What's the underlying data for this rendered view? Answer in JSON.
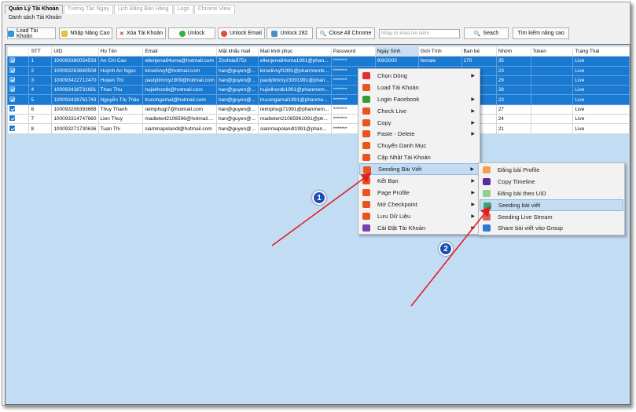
{
  "tabs": [
    "Quản Lý Tài Khoản",
    "Tương Tác Ngay",
    "Lịch Đăng Bán Hàng",
    "Logs",
    "Chrome View"
  ],
  "group_label": "Danh sách Tài Khoản",
  "toolbar": {
    "load": "Load Tài Khoản",
    "import": "Nhập Nâng Cao",
    "delete": "Xóa Tài Khoản",
    "unlock": "Unlock",
    "unlock_email": "Unlock Email",
    "unlock282": "Unlock 282",
    "close_chrome": "Close All Chrome",
    "search_placeholder": "Nhập từ khóa tìm kiếm",
    "search": "Seach",
    "advanced": "Tìm kiếm nâng cao"
  },
  "columns": [
    "",
    "STT",
    "UID",
    "Họ Tên",
    "Email",
    "Mật khẩu mail",
    "Mail khôi phục",
    "Password",
    "Ngày Sinh",
    "Giới Tính",
    "Bạn bè",
    "Nhóm",
    "Token",
    "Trạng Thái"
  ],
  "rows": [
    {
      "sel": true,
      "c": [
        "",
        "1",
        "100093380054533",
        "An Chi Cao",
        "ellenjena84oma@hotmail.com",
        "Zzohda975z",
        "ellenjena84oma1991@phan...",
        "*******",
        "9/8/2000",
        "female",
        "170",
        "35",
        "",
        "Live"
      ]
    },
    {
      "sel": true,
      "c": [
        "",
        "2",
        "100093263840508",
        "Huỳnh An Ngọc",
        "kirselivvyf@hotmail.com",
        "han@guyen@...",
        "kirselivvyf1991@phanmemb...",
        "*******",
        "10/14/1998",
        "female",
        "230",
        "23",
        "",
        "Live"
      ]
    },
    {
      "sel": true,
      "c": [
        "",
        "3",
        "100093422712470",
        "Huyen Thi",
        "paulytimmyz309@hotmail.com",
        "han@guyen@...",
        "paulytimmyz3091991@phan...",
        "*******",
        "",
        "",
        "",
        "29",
        "",
        "Live"
      ]
    },
    {
      "sel": true,
      "c": [
        "",
        "4",
        "100093438731691",
        "Thao Thu",
        "hujielhordb@hotmail.com",
        "han@guyen@...",
        "hujielhordb1991@phanmem...",
        "*******",
        "",
        "",
        "",
        "28",
        "",
        "Live"
      ]
    },
    {
      "sel": true,
      "c": [
        "",
        "5",
        "100093438761743",
        "Nguyễn Thị Thảo",
        "trucongamal@hotmail.com",
        "han@guyen@...",
        "trucongamal1991@phanme...",
        "*******",
        "",
        "",
        "",
        "23",
        "",
        "Live"
      ]
    },
    {
      "sel": false,
      "c": [
        "",
        "6",
        "100093206393668",
        "Thuy Thanh",
        "reimphugi7@hotmail.com",
        "han@guyen@...",
        "reimphugi71991@phanmem...",
        "*******",
        "",
        "",
        "",
        "27",
        "",
        "Live"
      ]
    },
    {
      "sel": false,
      "c": [
        "",
        "7",
        "100093314747660",
        "Lien Thuy",
        "madietert2106596@hotmail....",
        "han@guyen@...",
        "madietert21065961991@ph...",
        "*******",
        "",
        "",
        "",
        "24",
        "",
        "Live"
      ]
    },
    {
      "sel": false,
      "c": [
        "",
        "8",
        "100093271730636",
        "Tuan Thi",
        "siammapolandl@hotmail.com",
        "han@guyen@...",
        "siammapolandl1991@phan...",
        "*******",
        "",
        "",
        "",
        "21",
        "",
        "Live"
      ]
    }
  ],
  "context_menu": [
    {
      "label": "Chọn Dòng",
      "sub": true,
      "icon": "cursor-icon",
      "color": "#e03030"
    },
    {
      "label": "Load Tài Khoản",
      "sub": false,
      "icon": "power-icon",
      "color": "#e8541c"
    },
    {
      "label": "Login Facebook",
      "sub": true,
      "icon": "chrome-icon",
      "color": "#3a9a3a"
    },
    {
      "label": "Check Live",
      "sub": true,
      "icon": "check-icon",
      "color": "#e8541c"
    },
    {
      "label": "Copy",
      "sub": true,
      "icon": "copy-icon",
      "color": "#e8541c"
    },
    {
      "label": "Paste - Delete",
      "sub": true,
      "icon": "paste-icon",
      "color": "#e8541c"
    },
    {
      "label": "Chuyển Danh Mục",
      "sub": false,
      "icon": "move-icon",
      "color": "#e8541c"
    },
    {
      "label": "Cập Nhật Tài Khoản",
      "sub": false,
      "icon": "user-icon",
      "color": "#e8541c"
    },
    {
      "label": "Seeding Bài Viết",
      "sub": true,
      "icon": "comment-icon",
      "color": "#e8541c",
      "highlight": true
    },
    {
      "label": "Kết Bạn",
      "sub": true,
      "icon": "friends-icon",
      "color": "#e8541c"
    },
    {
      "label": "Page Profile",
      "sub": true,
      "icon": "page-icon",
      "color": "#e8541c"
    },
    {
      "label": "Mở Checkpoint",
      "sub": true,
      "icon": "unlock-icon",
      "color": "#e8541c"
    },
    {
      "label": "Lưu Dữ Liệu",
      "sub": true,
      "icon": "save-icon",
      "color": "#e8541c"
    },
    {
      "label": "Cài Đặt Tài Khoản",
      "sub": true,
      "icon": "gear-icon",
      "color": "#7a3fb0"
    }
  ],
  "submenu": [
    {
      "label": "Đăng bài Profile",
      "icon": "document-icon",
      "color": "#f0a050"
    },
    {
      "label": "Copy Timeline",
      "icon": "timeline-icon",
      "color": "#5b2d9a"
    },
    {
      "label": "Đăng bài theo UID",
      "icon": "play-icon",
      "color": "#8fd08f"
    },
    {
      "label": "Seeding bài viết",
      "icon": "seeding-icon",
      "color": "#2fa87a",
      "highlight": true
    },
    {
      "label": "Seeding Live Stream",
      "icon": "like-icon",
      "color": "#d86060"
    },
    {
      "label": "Share bài viết vào Group",
      "icon": "share-icon",
      "color": "#2a7ad0"
    }
  ],
  "annotations": [
    "1",
    "2"
  ],
  "colors": {
    "selection": "#1a79d0",
    "background": "#c2dcf4",
    "arrow": "#e02020"
  }
}
